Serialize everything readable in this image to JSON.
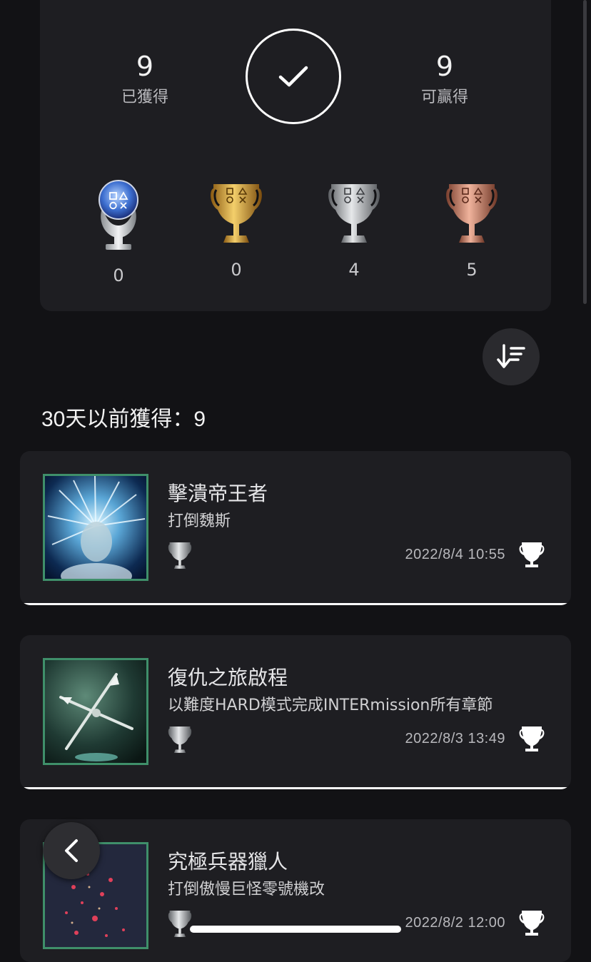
{
  "summary": {
    "earned": {
      "value": "9",
      "label": "已獲得"
    },
    "available": {
      "value": "9",
      "label": "可贏得"
    },
    "trophies": [
      {
        "type": "platinum",
        "count": "0"
      },
      {
        "type": "gold",
        "count": "0"
      },
      {
        "type": "silver",
        "count": "4"
      },
      {
        "type": "bronze",
        "count": "5"
      }
    ]
  },
  "section": {
    "title": "30天以前獲得：9"
  },
  "trophy_list": [
    {
      "title": "擊潰帝王者",
      "description": "打倒魏斯",
      "date": "2022/8/4 10:55",
      "grade": "silver"
    },
    {
      "title": "復仇之旅啟程",
      "description": "以難度HARD模式完成INTERmission所有章節",
      "date": "2022/8/3 13:49",
      "grade": "silver"
    },
    {
      "title": "究極兵器獵人",
      "description": "打倒傲慢巨怪零號機改",
      "date": "2022/8/2 12:00",
      "grade": "silver"
    }
  ],
  "colors": {
    "background": "#121215",
    "card": "#1e1e22",
    "accent_border": "#3f8f6a"
  },
  "icons": {
    "check": "check-icon",
    "sort": "sort-descending-icon",
    "back": "chevron-left-icon",
    "trophy": "trophy-icon"
  }
}
